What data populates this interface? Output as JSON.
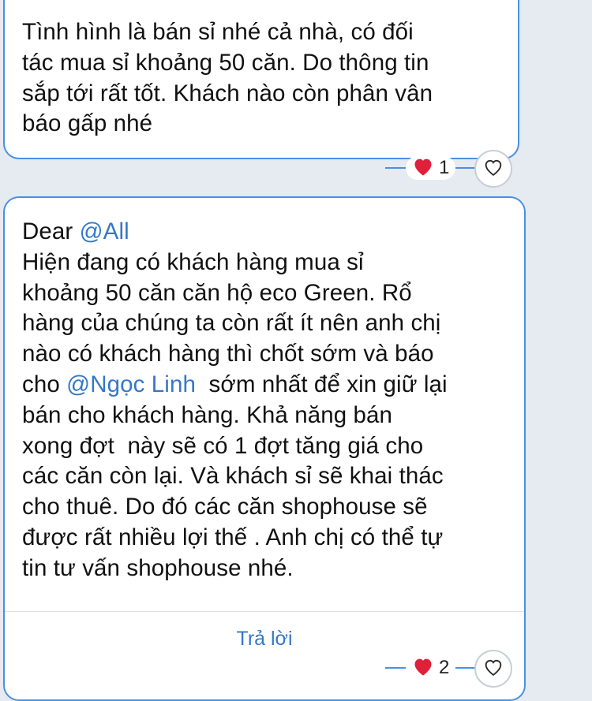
{
  "message1": {
    "lines": [
      "Tình hình là bán sỉ nhé cả nhà, có đối",
      "tác mua sỉ khoảng 50 căn. Do thông tin",
      "sắp tới rất tốt. Khách nào còn phân vân",
      "báo gấp nhé"
    ],
    "reaction_count": "1"
  },
  "message2": {
    "greeting": "Dear ",
    "mention_all": "@All",
    "line2": "Hiện đang có khách hàng mua sỉ",
    "line3": "khoảng 50 căn căn hộ eco Green. Rổ",
    "line4": "hàng của chúng ta còn rất ít nên anh chị",
    "line5": "nào có khách hàng thì chốt sớm và báo",
    "line6_prefix": "cho ",
    "mention_user": "@Ngọc Linh",
    "line6_suffix": "  sớm nhất để xin giữ lại",
    "line7": "bán cho khách hàng. Khả năng bán",
    "line8": "xong đợt  này sẽ có 1 đợt tăng giá cho",
    "line9": "các căn còn lại. Và khách sỉ sẽ khai thác",
    "line10": "cho thuê. Do đó các căn shophouse sẽ",
    "line11": "được rất nhiều lợi thế . Anh chị có thể tự",
    "line12": "tin tư vấn shophouse nhé.",
    "reply_label": "Trả lời",
    "reaction_count": "2"
  },
  "colors": {
    "accent": "#3478c6",
    "border": "#4a90e2",
    "heart": "#e0203a",
    "background": "#e6eaf1"
  },
  "icons": {
    "reaction": "heart-icon",
    "like": "heart-outline-icon"
  }
}
